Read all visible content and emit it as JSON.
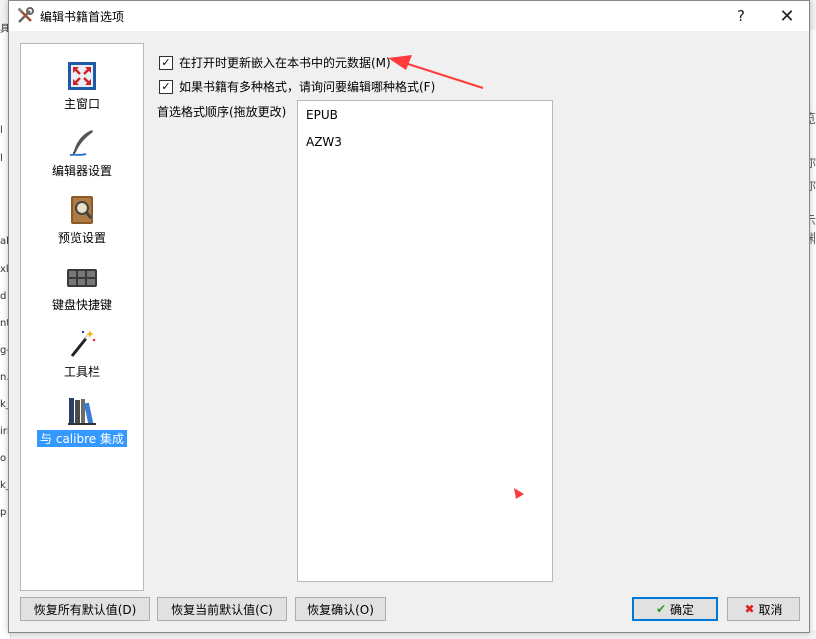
{
  "background": {
    "left_fragments": [
      "具",
      "l",
      "l",
      "al",
      "xl",
      "d",
      "nt",
      "g-",
      "n.",
      "k_",
      "iri",
      "o",
      "k_",
      "p"
    ],
    "right_fragments": [
      "览",
      "你",
      "你",
      "示",
      "渊"
    ]
  },
  "window": {
    "title": "编辑书籍首选项",
    "help_label": "?",
    "close_label": "✕"
  },
  "sidebar": {
    "items": [
      {
        "label": "主窗口",
        "icon": "main-window-icon"
      },
      {
        "label": "编辑器设置",
        "icon": "quill-pen-icon"
      },
      {
        "label": "预览设置",
        "icon": "preview-book-icon"
      },
      {
        "label": "键盘快捷键",
        "icon": "keyboard-icon"
      },
      {
        "label": "工具栏",
        "icon": "magic-wand-icon"
      },
      {
        "label": "与 calibre 集成",
        "icon": "bookshelf-icon",
        "selected": true
      }
    ]
  },
  "options": {
    "update_metadata": {
      "label": "在打开时更新嵌入在本书中的元数据(M)",
      "checked": true
    },
    "ask_format": {
      "label": "如果书籍有多种格式，请询问要编辑哪种格式(F)",
      "checked": true
    },
    "order_label": "首选格式顺序(拖放更改)",
    "formats": [
      "EPUB",
      "AZW3"
    ]
  },
  "buttons": {
    "restore_all": "恢复所有默认值(D)",
    "restore_current": "恢复当前默认值(C)",
    "restore_confirm": "恢复确认(O)",
    "ok": "确定",
    "cancel": "取消"
  },
  "colors": {
    "selection": "#3399ff",
    "annotation_arrow": "#ff3b3b"
  }
}
